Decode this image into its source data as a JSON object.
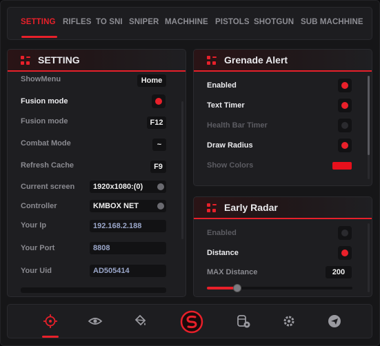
{
  "colors": {
    "accent": "#e8202a",
    "panel": "#1e1e21",
    "background": "#161618"
  },
  "tabs": [
    {
      "label": "SETTING",
      "active": true
    },
    {
      "label": "RIFLES",
      "active": false
    },
    {
      "label": "TO SNI",
      "active": false
    },
    {
      "label": "SNIPER",
      "active": false
    },
    {
      "label": "MACHHINE",
      "active": false
    },
    {
      "label": "PISTOLS",
      "active": false
    },
    {
      "label": "SHOTGUN",
      "active": false
    },
    {
      "label": "SUB MACHHINE",
      "active": false
    }
  ],
  "setting": {
    "title": "SETTING",
    "rows": {
      "showmenu": {
        "label": "ShowMenu",
        "value": "Home"
      },
      "fusion_mode_toggle": {
        "label": "Fusion mode",
        "checked": true
      },
      "fusion_mode_key": {
        "label": "Fusion mode",
        "value": "F12"
      },
      "combat_mode": {
        "label": "Combat Mode",
        "value": "~"
      },
      "refresh_cache": {
        "label": "Refresh Cache",
        "value": "F9"
      },
      "current_screen": {
        "label": "Current screen",
        "value": "1920x1080:(0)"
      },
      "controller": {
        "label": "Controller",
        "value": "KMBOX NET"
      },
      "your_ip": {
        "label": "Your Ip",
        "value": "192.168.2.188"
      },
      "your_port": {
        "label": "Your Port",
        "value": "8808"
      },
      "your_uid": {
        "label": "Your Uid",
        "value": "AD505414"
      }
    }
  },
  "grenade_alert": {
    "title": "Grenade Alert",
    "rows": {
      "enabled": {
        "label": "Enabled",
        "checked": true
      },
      "text_timer": {
        "label": "Text Timer",
        "checked": true
      },
      "health_bar_timer": {
        "label": "Health Bar Timer",
        "checked": false
      },
      "draw_radius": {
        "label": "Draw Radius",
        "checked": true
      },
      "show_colors": {
        "label": "Show Colors",
        "color": "#e8101c"
      }
    }
  },
  "early_radar": {
    "title": "Early Radar",
    "rows": {
      "enabled": {
        "label": "Enabled",
        "checked": false
      },
      "distance": {
        "label": "Distance",
        "checked": true
      },
      "max_distance": {
        "label": "MAX Distance",
        "value": "200",
        "fraction": 0.21
      }
    }
  },
  "bottom_nav": [
    {
      "icon": "crosshair-icon",
      "active": true
    },
    {
      "icon": "eye-icon",
      "active": false
    },
    {
      "icon": "paint-bucket-icon",
      "active": false
    },
    {
      "icon": "logo-icon",
      "active": false
    },
    {
      "icon": "car-settings-icon",
      "active": false
    },
    {
      "icon": "gear-icon",
      "active": false
    },
    {
      "icon": "send-icon",
      "active": false
    }
  ]
}
